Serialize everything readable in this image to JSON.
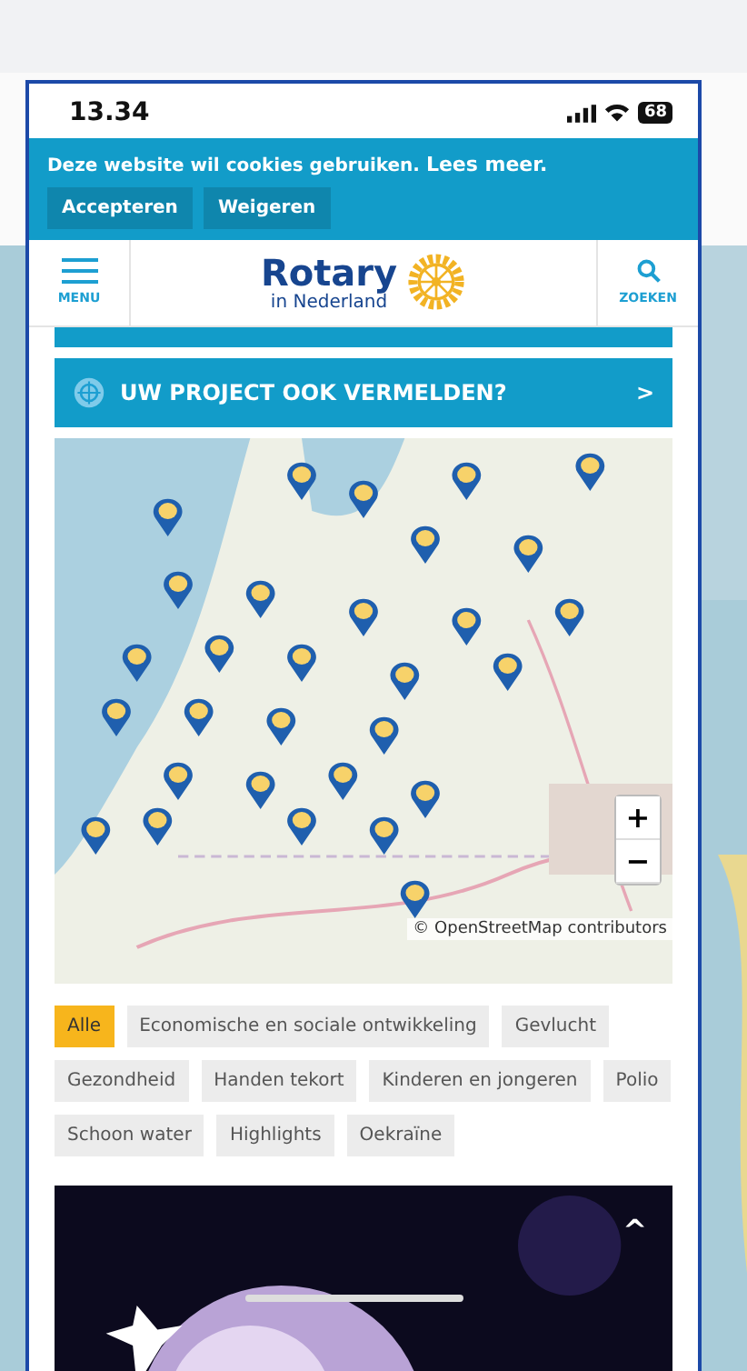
{
  "status_bar": {
    "time": "13.34",
    "battery": "68"
  },
  "cookie_banner": {
    "text": "Deze website wil cookies gebruiken.",
    "link": "Lees meer.",
    "buttons": [
      "Accepteren",
      "Weigeren"
    ]
  },
  "header": {
    "menu_label": "MENU",
    "logo_title": "Rotary",
    "logo_subtitle": "in Nederland",
    "search_label": "ZOEKEN"
  },
  "cta_banner": {
    "label": "UW PROJECT OOK VERMELDEN?",
    "arrow": ">"
  },
  "map": {
    "zoom_in": "+",
    "zoom_out": "−",
    "attribution": "© OpenStreetMap contributors"
  },
  "filters": [
    {
      "label": "Alle",
      "selected": true
    },
    {
      "label": "Economische en sociale ontwikkeling",
      "selected": false
    },
    {
      "label": "Gevlucht",
      "selected": false
    },
    {
      "label": "Gezondheid",
      "selected": false
    },
    {
      "label": "Handen tekort",
      "selected": false
    },
    {
      "label": "Kinderen en jongeren",
      "selected": false
    },
    {
      "label": "Polio",
      "selected": false
    },
    {
      "label": "Schoon water",
      "selected": false
    },
    {
      "label": "Highlights",
      "selected": false
    },
    {
      "label": "Oekraïne",
      "selected": false
    }
  ],
  "feature": {
    "kind": "picture",
    "scroll_top": "^"
  }
}
